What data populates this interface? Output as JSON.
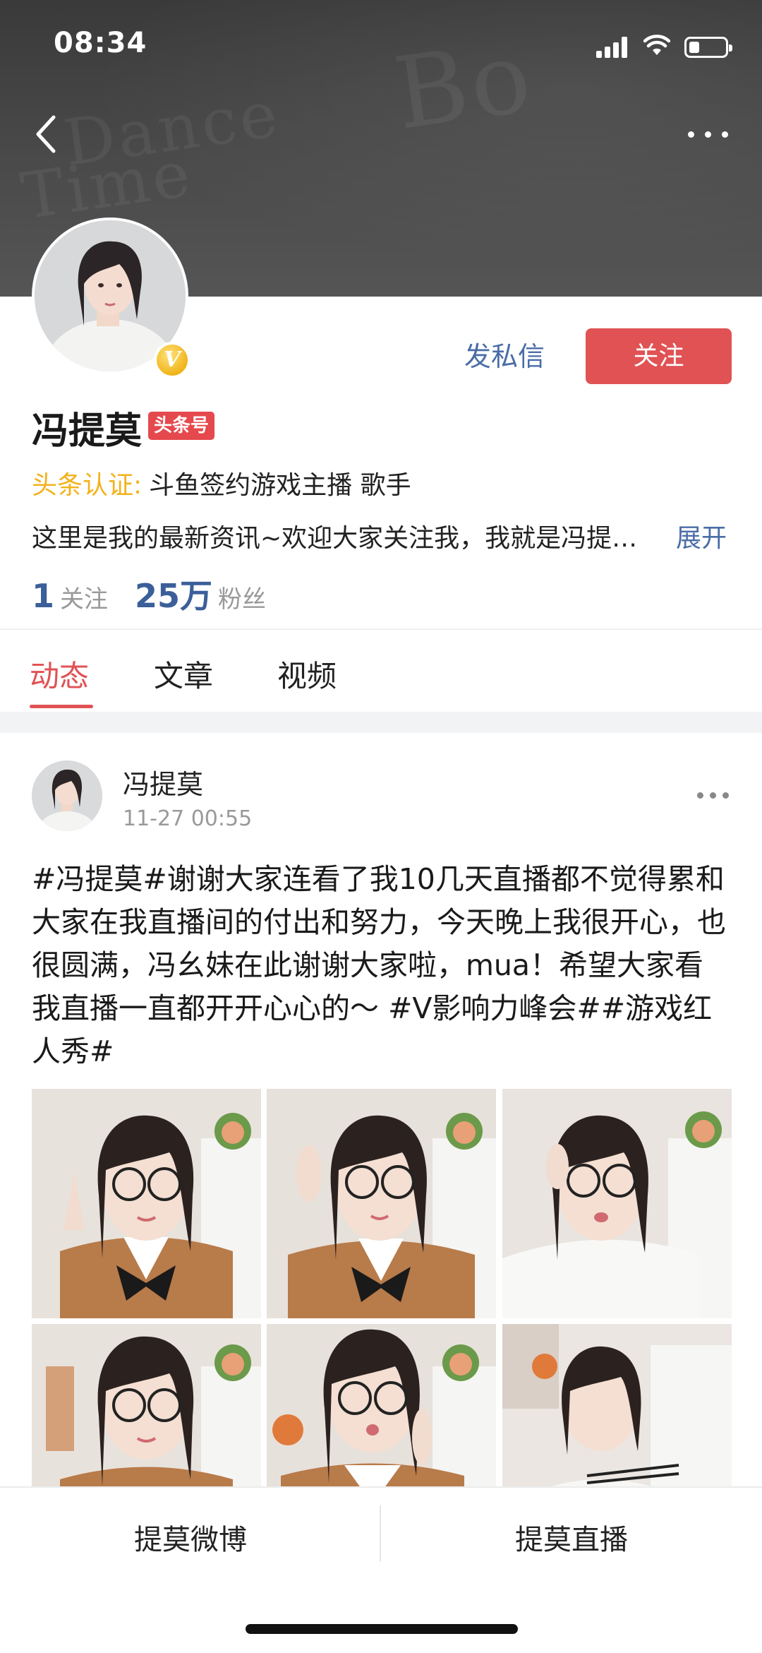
{
  "status_bar": {
    "time": "08:34"
  },
  "header": {
    "back_icon": "chevron-left-icon",
    "more_icon": "more-horizontal-icon"
  },
  "profile": {
    "name": "冯提莫",
    "tag": "头条号",
    "verify_badge": "V",
    "auth_label": "头条认证:",
    "auth_value": "斗鱼签约游戏主播 歌手",
    "bio": "这里是我的最新资讯~欢迎大家关注我，我就是冯提…",
    "expand_label": "展开",
    "following_count": "1",
    "following_label": "关注",
    "followers_count": "25万",
    "followers_label": "粉丝",
    "message_button": "发私信",
    "follow_button": "关注"
  },
  "tabs": [
    {
      "label": "动态",
      "active": true
    },
    {
      "label": "文章",
      "active": false
    },
    {
      "label": "视频",
      "active": false
    }
  ],
  "post": {
    "author": "冯提莫",
    "time": "11-27 00:55",
    "text": "#冯提莫#谢谢大家连看了我10几天直播都不觉得累和大家在我直播间的付出和努力，今天晚上我很开心，也很圆满，冯幺妹在此谢谢大家啦，mua！希望大家看我直播一直都开开心心的～ #V影响力峰会##游戏红人秀#",
    "image_count": 6
  },
  "bottom_bar": {
    "left_button": "提莫微博",
    "right_button": "提莫直播"
  },
  "colors": {
    "accent_red": "#e05254",
    "link_blue": "#4a6da7",
    "auth_gold": "#f2b21b",
    "stat_blue": "#3b5f99"
  }
}
